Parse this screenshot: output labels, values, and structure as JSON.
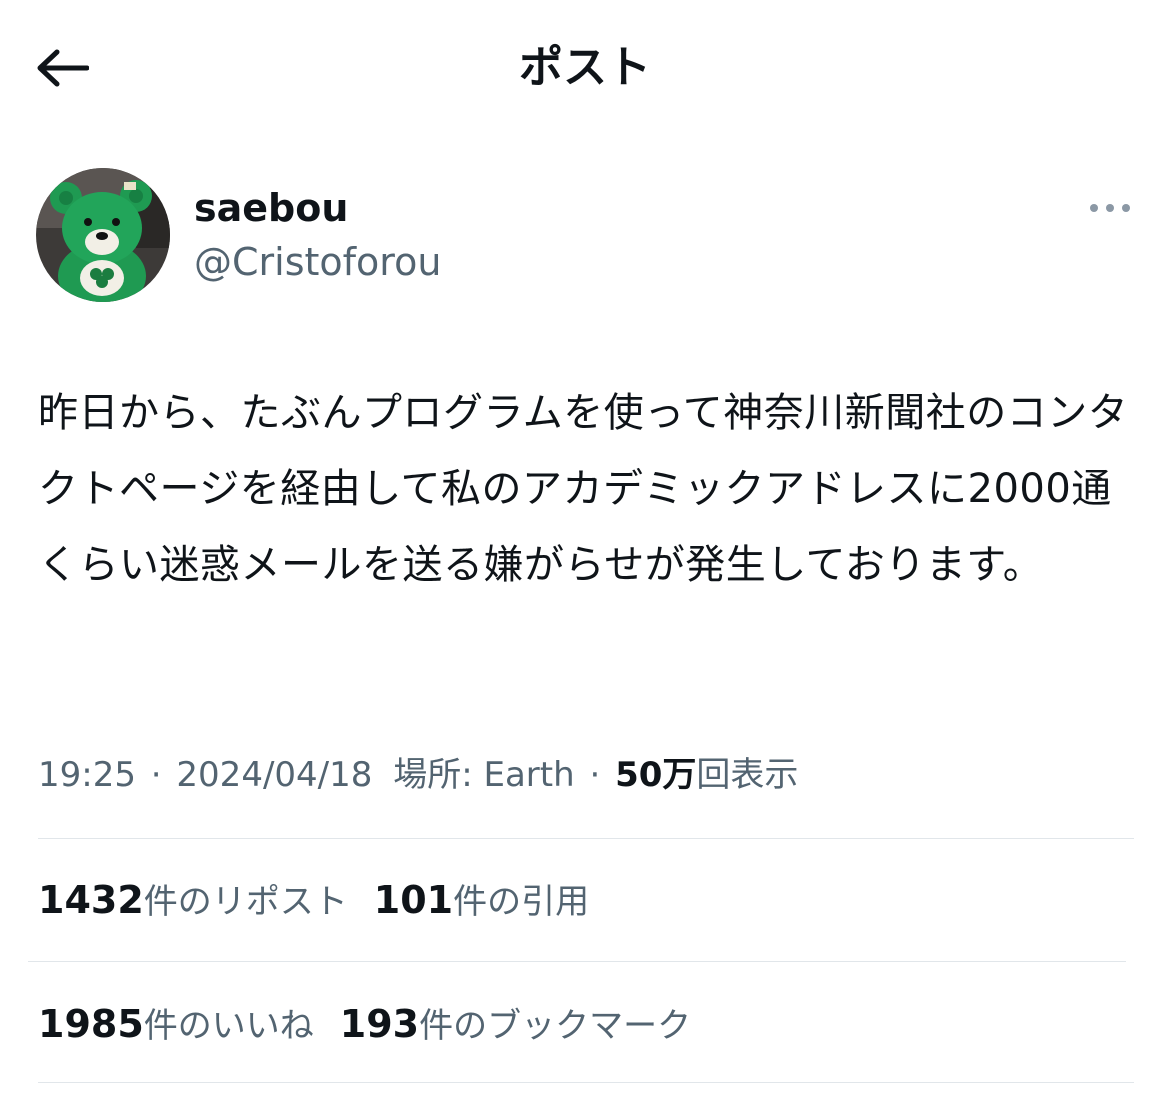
{
  "header": {
    "title": "ポスト",
    "back_icon": "arrow-left-icon"
  },
  "author": {
    "display_name": "saebou",
    "handle": "@Cristoforou",
    "avatar": "green-teddy-bear-avatar",
    "more_icon": "more-dots-icon"
  },
  "post": {
    "text": "昨日から、たぶんプログラムを使って神奈川新聞社のコンタクトページを経由して私のアカデミックアドレスに2000通くらい迷惑メールを送る嫌がらせが発生しております。"
  },
  "meta": {
    "time": "19:25",
    "separator": "·",
    "date": "2024/04/18",
    "location": "場所: Earth",
    "views_count": "50万",
    "views_label": "回表示"
  },
  "stats": {
    "reposts": {
      "count": "1432",
      "label": "件のリポスト"
    },
    "quotes": {
      "count": "101",
      "label": "件の引用"
    },
    "likes": {
      "count": "1985",
      "label": "件のいいね"
    },
    "bookmarks": {
      "count": "193",
      "label": "件のブックマーク"
    }
  },
  "colors": {
    "text_primary": "#0f1419",
    "text_secondary": "#536471",
    "divider": "#e1e6ea",
    "avatar_green": "#1f9a52"
  }
}
